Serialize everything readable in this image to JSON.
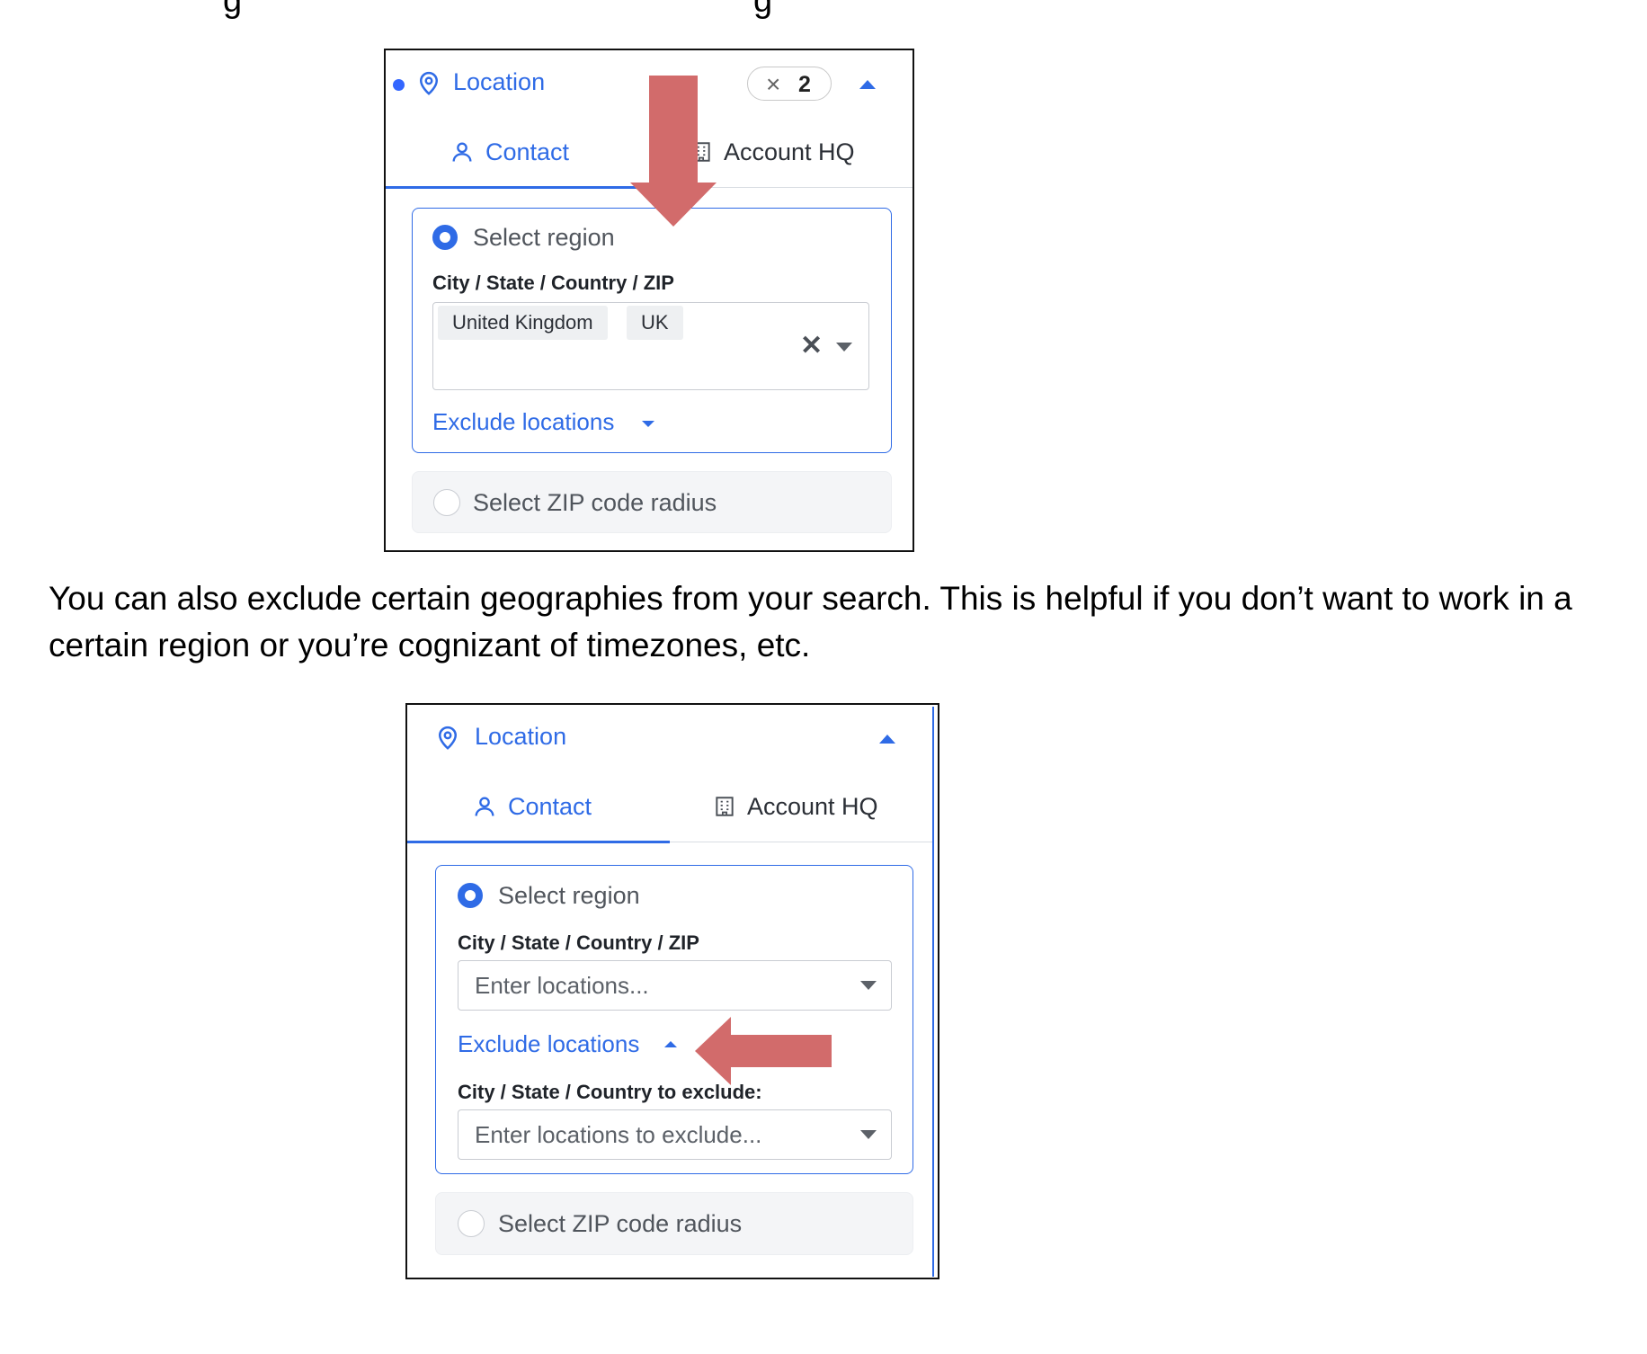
{
  "doc": {
    "top_partial": "g",
    "paragraph": "You can also exclude certain geographies from your search. This is helpful if you don’t want to work in a certain region or you’re cognizant of timezones, etc."
  },
  "panel1": {
    "header": {
      "title": "Location",
      "clear_count": "2"
    },
    "tabs": [
      {
        "label": "Contact"
      },
      {
        "label": "Account HQ"
      }
    ],
    "region_option": "Select region",
    "field_label": "City / State / Country / ZIP",
    "chips": [
      "United Kingdom",
      "UK"
    ],
    "exclude_link": "Exclude locations",
    "zip_option": "Select ZIP code radius"
  },
  "panel2": {
    "header": {
      "title": "Location"
    },
    "tabs": [
      {
        "label": "Contact"
      },
      {
        "label": "Account HQ"
      }
    ],
    "region_option": "Select region",
    "field_label": "City / State / Country / ZIP",
    "field_placeholder": "Enter locations...",
    "exclude_link": "Exclude locations",
    "exclude_label": "City / State / Country to exclude:",
    "exclude_placeholder": "Enter locations to exclude...",
    "zip_option": "Select ZIP code radius"
  },
  "colors": {
    "accent": "#2f6be6",
    "annotation_arrow": "#d26b6b",
    "text": "#1f2329"
  },
  "icons": [
    "location-pin-icon",
    "user-icon",
    "building-icon",
    "close-icon",
    "chevron-up-icon",
    "chevron-down-icon"
  ]
}
